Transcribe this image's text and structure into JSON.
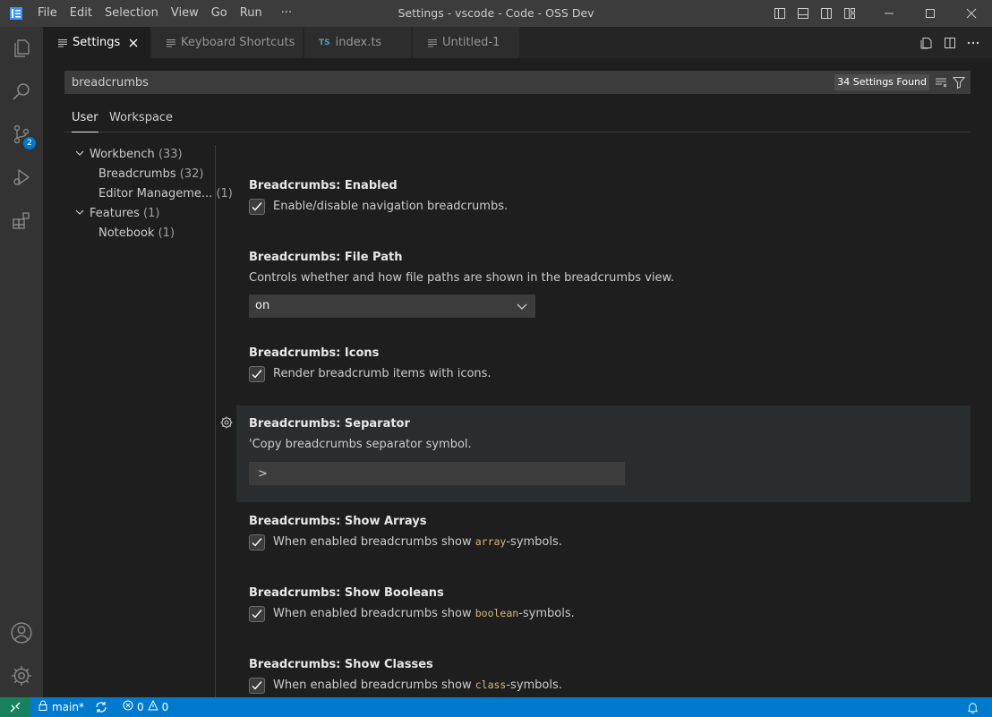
{
  "window": {
    "title": "Settings - vscode - Code - OSS Dev"
  },
  "menu": [
    "File",
    "Edit",
    "Selection",
    "View",
    "Go",
    "Run",
    "···"
  ],
  "activity": {
    "scm_badge": "2"
  },
  "tabs": [
    {
      "label": "Settings",
      "icon": "settings-lines"
    },
    {
      "label": "Keyboard Shortcuts",
      "icon": "settings-lines"
    },
    {
      "label": "index.ts",
      "icon": "TS"
    },
    {
      "label": "Untitled-1",
      "icon": "settings-lines"
    }
  ],
  "search": {
    "value": "breadcrumbs",
    "found": "34 Settings Found"
  },
  "scopes": [
    "User",
    "Workspace"
  ],
  "toc": [
    {
      "label": "Workbench",
      "count": "(33)"
    },
    {
      "label": "Breadcrumbs",
      "count": "(32)"
    },
    {
      "label": "Editor Manageme...",
      "count": "(1)"
    },
    {
      "label": "Features",
      "count": "(1)"
    },
    {
      "label": "Notebook",
      "count": "(1)"
    }
  ],
  "settings": {
    "enabled": {
      "category": "Breadcrumbs: ",
      "name": "Enabled",
      "desc": "Enable/disable navigation breadcrumbs.",
      "checked": true
    },
    "file_path": {
      "category": "Breadcrumbs: ",
      "name": "File Path",
      "desc": "Controls whether and how file paths are shown in the breadcrumbs view.",
      "value": "on"
    },
    "icons": {
      "category": "Breadcrumbs: ",
      "name": "Icons",
      "desc": "Render breadcrumb items with icons.",
      "checked": true
    },
    "separator": {
      "category": "Breadcrumbs: ",
      "name": "Separator",
      "desc": "'Copy breadcrumbs separator symbol.",
      "value": ">"
    },
    "show_arrays": {
      "category": "Breadcrumbs: ",
      "name": "Show Arrays",
      "desc_pre": "When enabled breadcrumbs show ",
      "code": "array",
      "desc_post": "-symbols.",
      "checked": true
    },
    "show_booleans": {
      "category": "Breadcrumbs: ",
      "name": "Show Booleans",
      "desc_pre": "When enabled breadcrumbs show ",
      "code": "boolean",
      "desc_post": "-symbols.",
      "checked": true
    },
    "show_classes": {
      "category": "Breadcrumbs: ",
      "name": "Show Classes",
      "desc_pre": "When enabled breadcrumbs show ",
      "code": "class",
      "desc_post": "-symbols.",
      "checked": true
    }
  },
  "statusbar": {
    "branch": "main*",
    "errors": "0",
    "warnings": "0"
  },
  "colors": {
    "accent": "#007acc",
    "remote": "#16825d",
    "code_token": "#d7ba7d"
  }
}
